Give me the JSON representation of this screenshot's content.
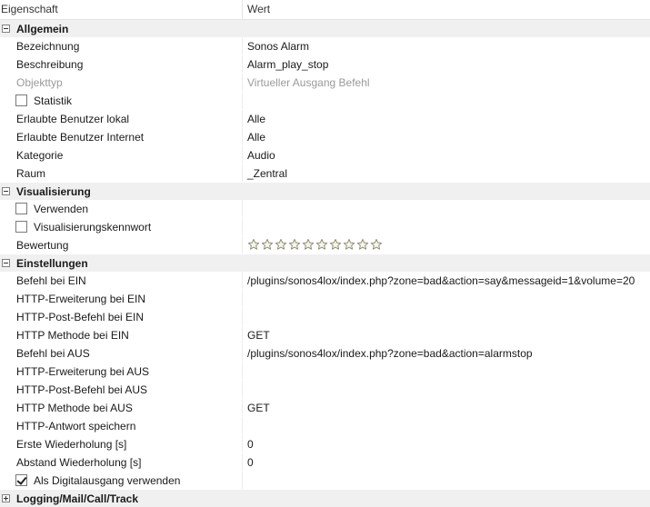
{
  "header": {
    "property": "Eigenschaft",
    "value": "Wert"
  },
  "sections": [
    {
      "title": "Allgemein",
      "expanded": true,
      "rows": [
        {
          "label": "Bezeichnung",
          "value": "Sonos Alarm"
        },
        {
          "label": "Beschreibung",
          "value": "Alarm_play_stop"
        },
        {
          "label": "Objekttyp",
          "value": "Virtueller Ausgang Befehl",
          "disabled": true
        },
        {
          "label": "Statistik",
          "value": "",
          "checkbox": false
        },
        {
          "label": "Erlaubte Benutzer lokal",
          "value": "Alle"
        },
        {
          "label": "Erlaubte Benutzer Internet",
          "value": "Alle"
        },
        {
          "label": "Kategorie",
          "value": "Audio"
        },
        {
          "label": "Raum",
          "value": "_Zentral"
        }
      ]
    },
    {
      "title": "Visualisierung",
      "expanded": true,
      "rows": [
        {
          "label": "Verwenden",
          "value": "",
          "checkbox": false
        },
        {
          "label": "Visualisierungskennwort",
          "value": "",
          "checkbox": false
        },
        {
          "label": "Bewertung",
          "value": "",
          "rating": 0,
          "rating_max": 10
        }
      ]
    },
    {
      "title": "Einstellungen",
      "expanded": true,
      "rows": [
        {
          "label": "Befehl bei EIN",
          "value": "/plugins/sonos4lox/index.php?zone=bad&action=say&messageid=1&volume=20"
        },
        {
          "label": "HTTP-Erweiterung bei EIN",
          "value": ""
        },
        {
          "label": "HTTP-Post-Befehl bei EIN",
          "value": ""
        },
        {
          "label": "HTTP Methode bei EIN",
          "value": "GET"
        },
        {
          "label": "Befehl bei AUS",
          "value": "/plugins/sonos4lox/index.php?zone=bad&action=alarmstop"
        },
        {
          "label": "HTTP-Erweiterung bei AUS",
          "value": ""
        },
        {
          "label": "HTTP-Post-Befehl bei AUS",
          "value": ""
        },
        {
          "label": "HTTP Methode bei AUS",
          "value": "GET"
        },
        {
          "label": "HTTP-Antwort speichern",
          "value": ""
        },
        {
          "label": "Erste Wiederholung [s]",
          "value": "0"
        },
        {
          "label": "Abstand Wiederholung [s]",
          "value": "0"
        },
        {
          "label": "Als Digitalausgang verwenden",
          "value": "",
          "checkbox": true
        }
      ]
    },
    {
      "title": "Logging/Mail/Call/Track",
      "expanded": false,
      "rows": []
    }
  ],
  "colors": {
    "category_bg": "#f0f0f0",
    "disabled_text": "#9a9a9a",
    "star_outline": "#8a8a6a"
  }
}
